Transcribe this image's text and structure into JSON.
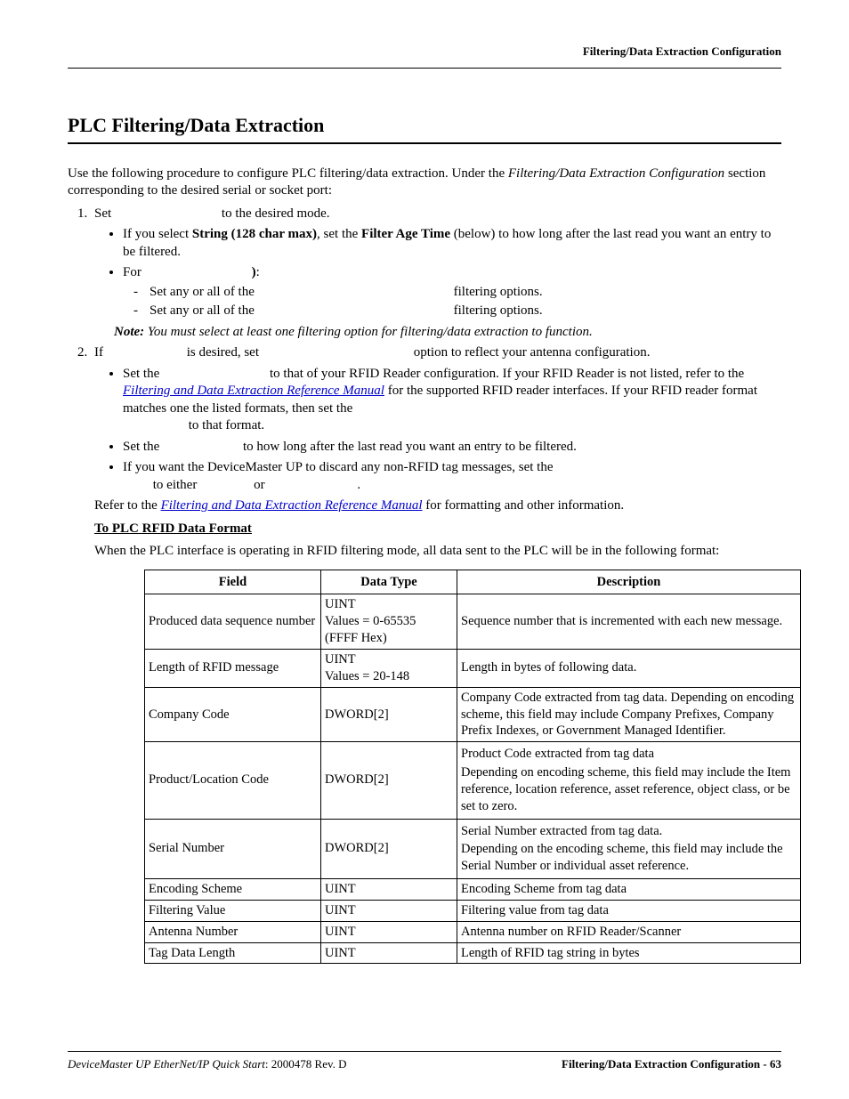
{
  "header": {
    "right": "Filtering/Data Extraction Configuration"
  },
  "section_title": "PLC Filtering/Data Extraction",
  "intro": {
    "pre": "Use the following procedure to configure PLC filtering/data extraction. Under the ",
    "ital": "Filtering/Data Extraction Configuration",
    "post": " section corresponding to the desired serial or socket port:"
  },
  "step1": {
    "set_pre": "Set",
    "set_post": " to the desired mode.",
    "b1_pre": "If you select ",
    "b1_bold1": "String (128 char max)",
    "b1_mid": ", set the ",
    "b1_bold2": "Filter Age Time",
    "b1_post": " (below) to how long after the last read you want an entry to be filtered.",
    "b2_pre": "For",
    "b2_bold": " )",
    "b2_post": ":",
    "d1_pre": "Set any or all of the",
    "d1_post": " filtering options.",
    "d2_pre": "Set any or all of the",
    "d2_post": " filtering options."
  },
  "note": {
    "label": "Note:",
    "text": "  You must select at least one filtering option for filtering/data extraction to function."
  },
  "step2": {
    "if_pre": "If",
    "if_mid": " is desired, set",
    "if_post": " option to reflect your antenna configuration.",
    "c1_pre": "Set the",
    "c1_mid": " to that of your RFID Reader configuration. If your RFID Reader is not listed, refer to the ",
    "c1_link": "Filtering and Data Extraction Reference Manual",
    "c1_post": " for the supported RFID reader interfaces. If your RFID reader format matches one the listed formats, then set the ",
    "c1_tail": " to that format.",
    "c2_pre": "Set the",
    "c2_post": " to how long after the last read you want an entry to be filtered.",
    "c3_pre": "If you want the DeviceMaster UP to discard any non-RFID tag messages, set the ",
    "c3_mid": " to either",
    "c3_or": " or",
    "c3_end": " .",
    "refer_pre": "Refer to the ",
    "refer_link": "Filtering and Data Extraction Reference Manual",
    "refer_post": " for formatting and other information.",
    "subhead": "To PLC RFID Data Format",
    "when": "When the PLC interface is operating in RFID filtering mode, all data sent to the PLC will be in the following format:"
  },
  "table": {
    "headers": {
      "c1": "Field",
      "c2": "Data Type",
      "c3": "Description"
    },
    "rows": [
      {
        "field": "Produced data sequence number",
        "type_l1": "UINT",
        "type_l2": "Values = 0-65535",
        "type_l3": "(FFFF Hex)",
        "desc": "Sequence number that is incremented with each new message."
      },
      {
        "field": "Length of RFID message",
        "type_l1": "UINT",
        "type_l2": "Values = 20-148",
        "type_l3": "",
        "desc": "Length in bytes of following data."
      },
      {
        "field": "Company Code",
        "type_l1": "DWORD[2]",
        "type_l2": "",
        "type_l3": "",
        "desc": "Company Code extracted from tag data. Depending on encoding scheme, this field may include Company Prefixes, Company Prefix Indexes, or Government Managed Identifier."
      },
      {
        "field": "Product/Location Code",
        "type_l1": "DWORD[2]",
        "type_l2": "",
        "type_l3": "",
        "desc_p1": "Product Code extracted from tag data",
        "desc_p2": "Depending on encoding scheme, this field may include the Item reference, location reference, asset reference, object class, or be set to zero."
      },
      {
        "field": "Serial Number",
        "type_l1": "DWORD[2]",
        "type_l2": "",
        "type_l3": "",
        "desc_p1": "Serial Number extracted from tag data.",
        "desc_p2": "Depending on the encoding scheme, this field may include the Serial Number or individual asset reference."
      },
      {
        "field": "Encoding Scheme",
        "type_l1": "UINT",
        "type_l2": "",
        "type_l3": "",
        "desc": "Encoding Scheme from tag data"
      },
      {
        "field": "Filtering Value",
        "type_l1": "UINT",
        "type_l2": "",
        "type_l3": "",
        "desc": "Filtering value from tag data"
      },
      {
        "field": "Antenna Number",
        "type_l1": "UINT",
        "type_l2": "",
        "type_l3": "",
        "desc": "Antenna number on RFID Reader/Scanner"
      },
      {
        "field": "Tag Data Length",
        "type_l1": "UINT",
        "type_l2": "",
        "type_l3": "",
        "desc": "Length of RFID tag string in bytes"
      }
    ]
  },
  "footer": {
    "left_ital": "DeviceMaster UP EtherNet/IP Quick Start",
    "left_rest": ": 2000478 Rev. D",
    "right": "Filtering/Data Extraction Configuration - 63"
  }
}
